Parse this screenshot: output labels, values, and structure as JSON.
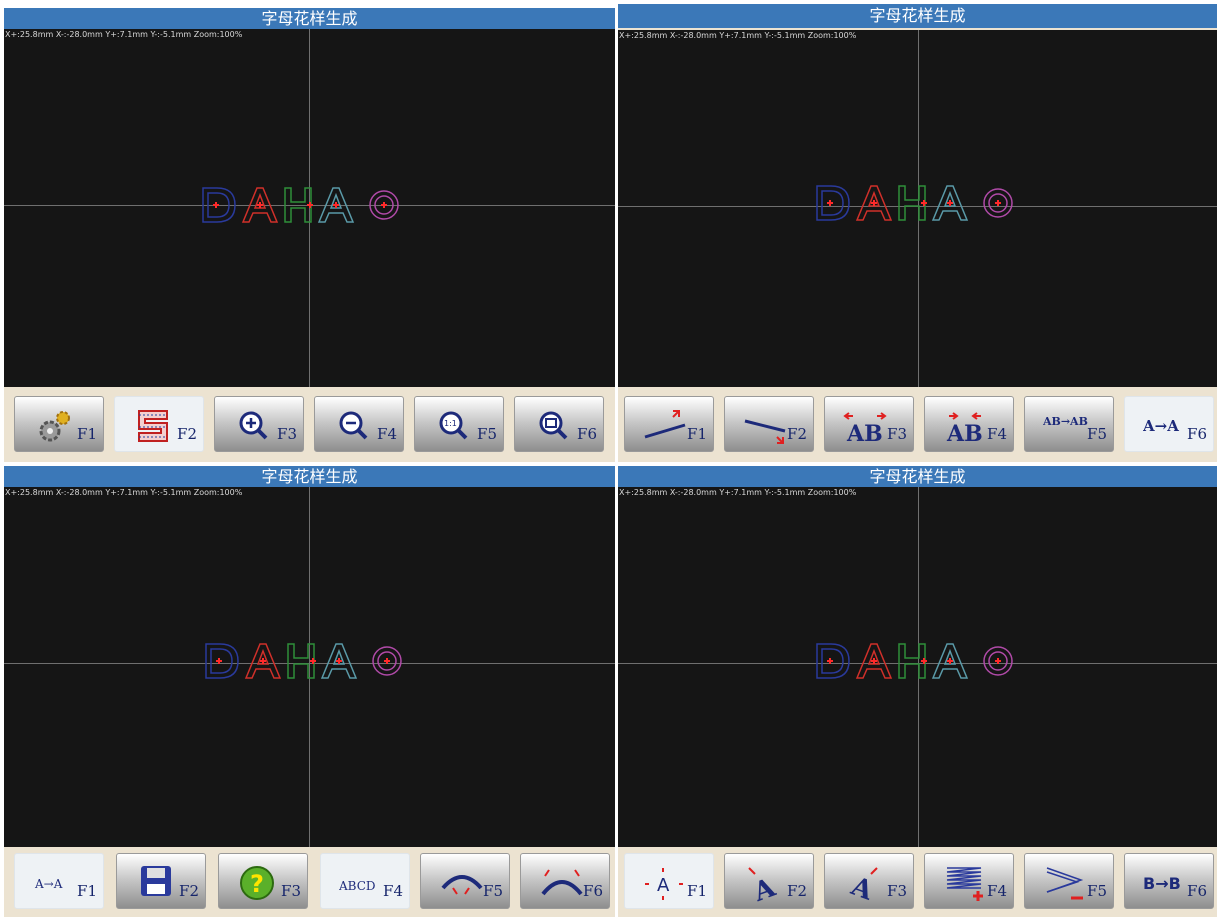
{
  "colors": {
    "titlebar": "#3b78b8",
    "canvas": "#151515",
    "frame": "#ece3d1",
    "letterD": "#2a3a9c",
    "letterA": "#d0302a",
    "letterH": "#2e8f3a",
    "letterA2": "#5a9aa8",
    "letterO": "#b04aa8",
    "marker": "#ff2a2a"
  },
  "panels": [
    {
      "title": "字母花样生成",
      "readout": "X+:25.8mm  X-:-28.0mm  Y+:7.1mm Y-:-5.1mm Zoom:100%",
      "letters": "DAHAO",
      "buttons": [
        {
          "icon": "gear-icon",
          "key": "F1"
        },
        {
          "icon": "pattern-icon",
          "key": "F2"
        },
        {
          "icon": "zoom-in-icon",
          "key": "F3"
        },
        {
          "icon": "zoom-out-icon",
          "key": "F4"
        },
        {
          "icon": "zoom-actual-icon",
          "key": "F5"
        },
        {
          "icon": "zoom-fit-icon",
          "key": "F6"
        }
      ]
    },
    {
      "title": "字母花样生成",
      "readout": "X+:25.8mm  X-:-28.0mm  Y+:7.1mm Y-:-5.1mm Zoom:100%",
      "letters": "DAHAO",
      "buttons": [
        {
          "icon": "line-up-icon",
          "key": "F1"
        },
        {
          "icon": "line-down-icon",
          "key": "F2"
        },
        {
          "icon": "spacing-wide-icon",
          "key": "F3",
          "text": "AB"
        },
        {
          "icon": "spacing-narrow-icon",
          "key": "F4",
          "text": "AB"
        },
        {
          "icon": "text-replace-icon",
          "key": "F5",
          "text": "AB→AB"
        },
        {
          "icon": "resize-letter-icon",
          "key": "F6",
          "text": "A→A"
        }
      ]
    },
    {
      "title": "字母花样生成",
      "readout": "X+:25.8mm  X-:-28.0mm  Y+:7.1mm Y-:-5.1mm Zoom:100%",
      "letters": "DAHAO",
      "buttons": [
        {
          "icon": "font-size-icon",
          "key": "F1",
          "text": "A→A"
        },
        {
          "icon": "save-icon",
          "key": "F2"
        },
        {
          "icon": "help-icon",
          "key": "F3",
          "text": "?"
        },
        {
          "icon": "abcd-arc-icon",
          "key": "F4",
          "text": "ABCD"
        },
        {
          "icon": "arc-down-icon",
          "key": "F5"
        },
        {
          "icon": "arc-up-icon",
          "key": "F6"
        }
      ]
    },
    {
      "title": "字母花样生成",
      "readout": "X+:25.8mm  X-:-28.0mm  Y+:7.1mm Y-:-5.1mm Zoom:100%",
      "letters": "DAHAO",
      "buttons": [
        {
          "icon": "move-letter-icon",
          "key": "F1",
          "text": "A"
        },
        {
          "icon": "rotate-left-icon",
          "key": "F2",
          "text": "A"
        },
        {
          "icon": "rotate-right-icon",
          "key": "F3",
          "text": "A"
        },
        {
          "icon": "stitch-add-icon",
          "key": "F4"
        },
        {
          "icon": "zigzag-remove-icon",
          "key": "F5"
        },
        {
          "icon": "font-switch-icon",
          "key": "F6",
          "text": "B→B"
        }
      ]
    }
  ]
}
